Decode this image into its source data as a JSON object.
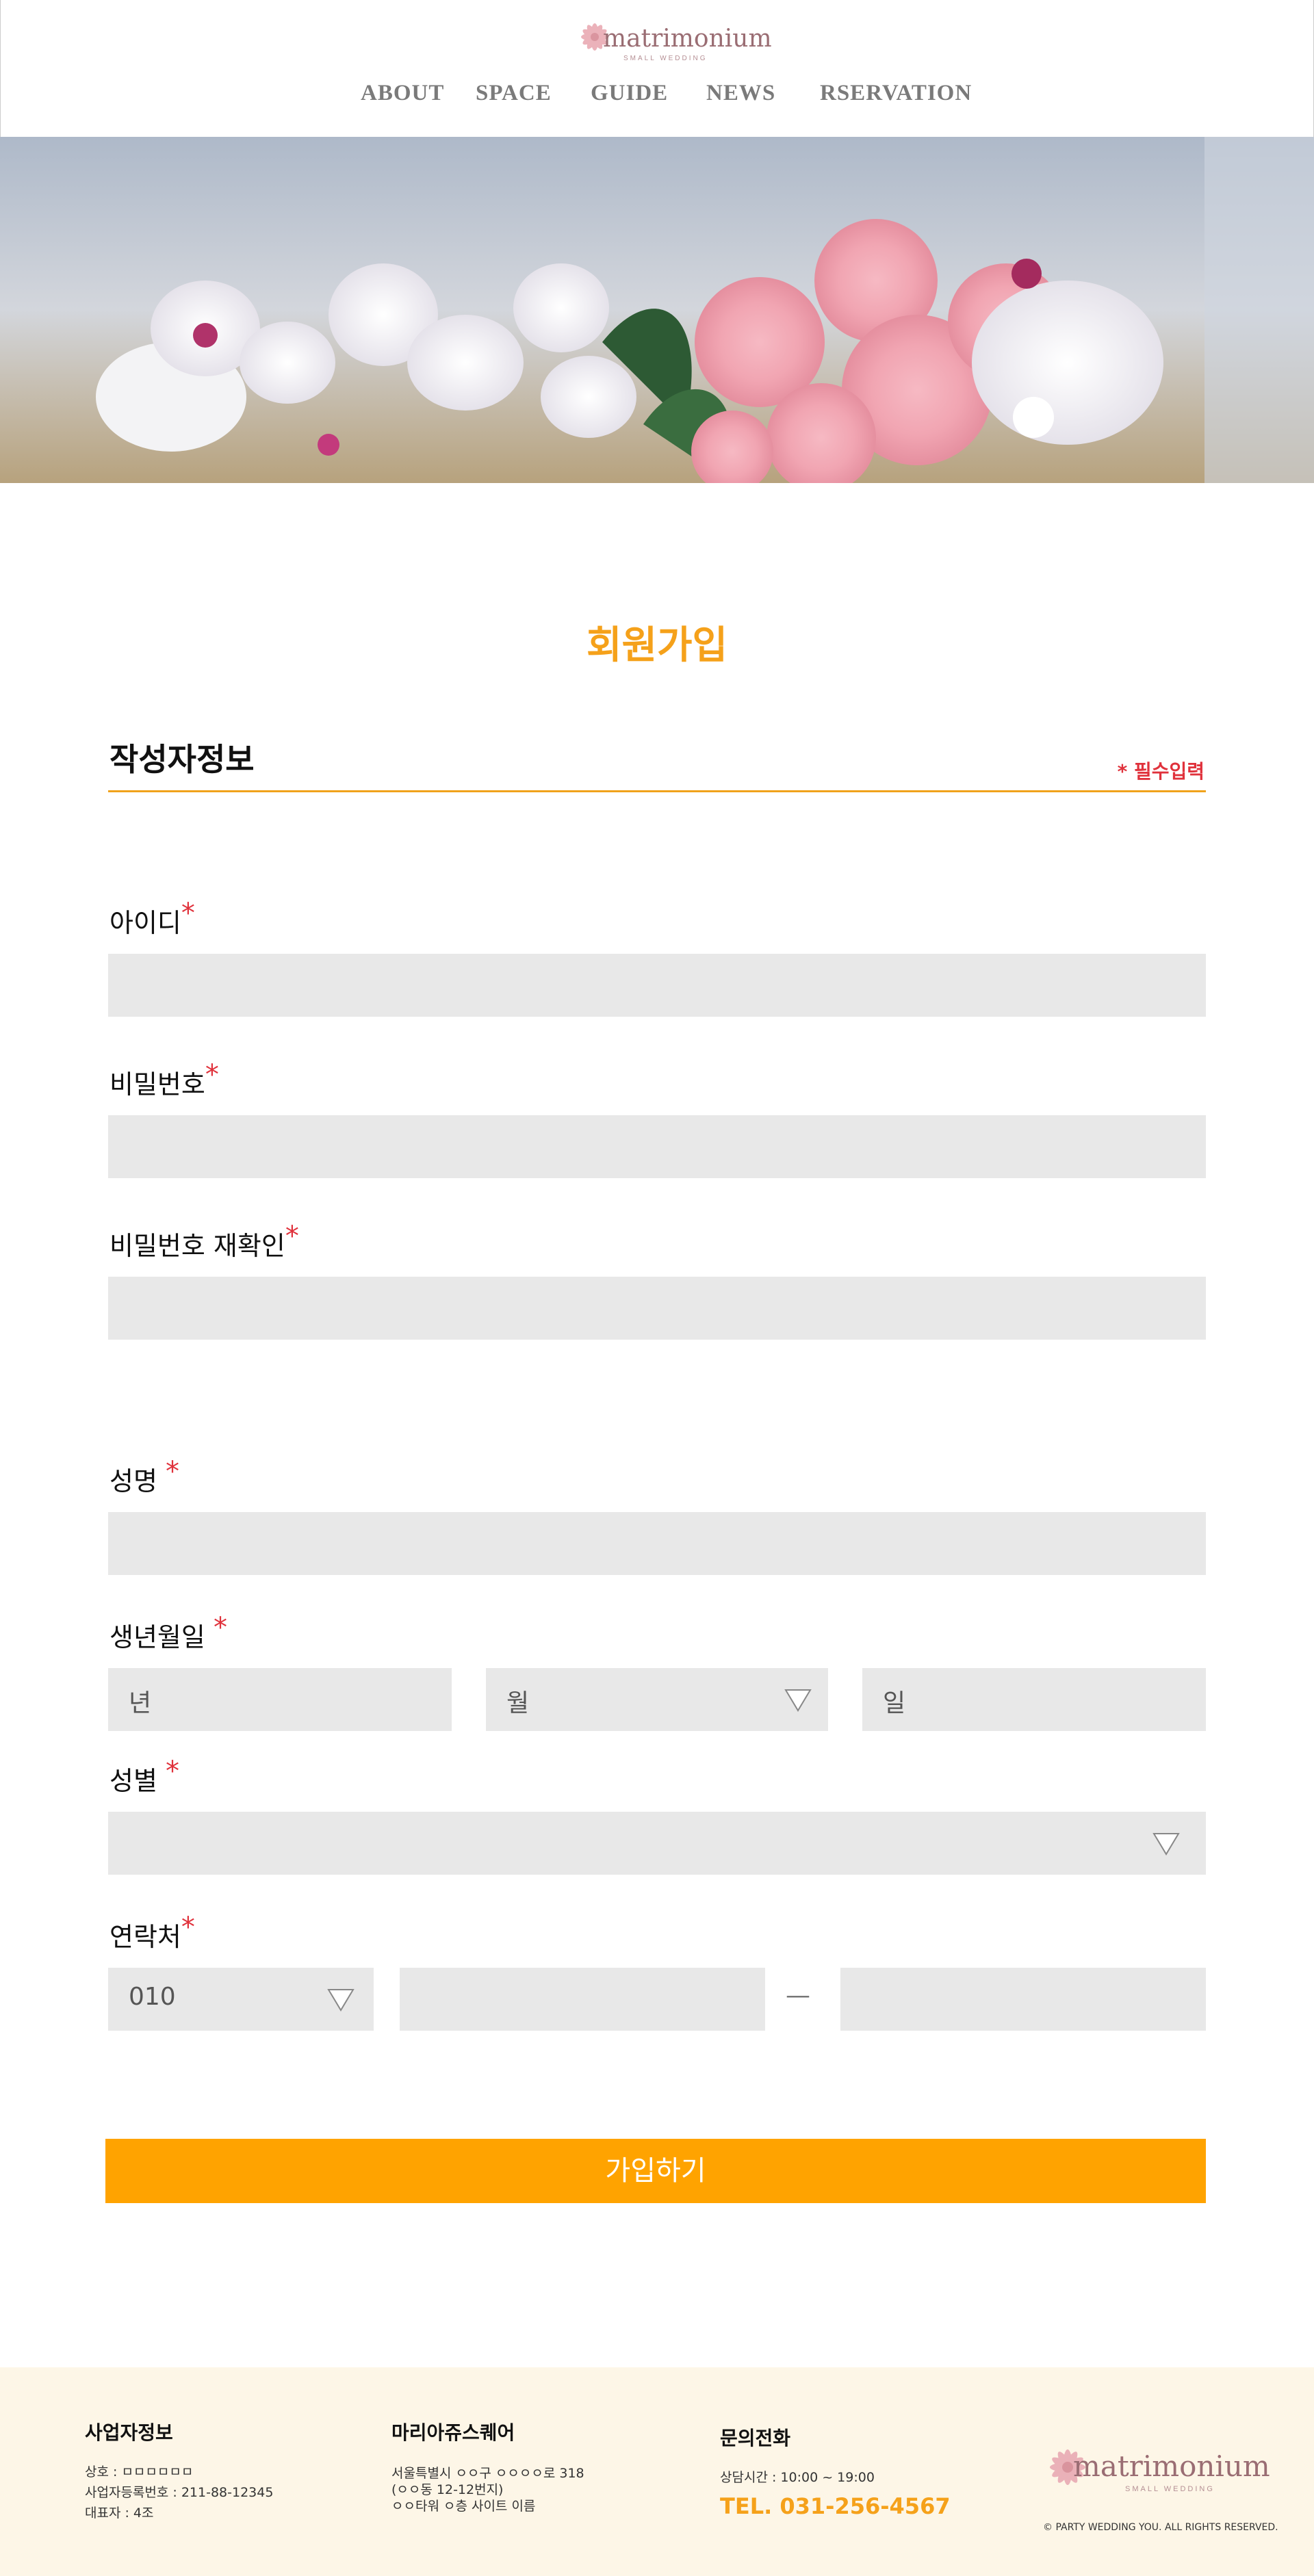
{
  "brand": {
    "name": "matrimonium",
    "tagline": "SMALL WEDDING"
  },
  "nav": {
    "items": [
      "ABOUT",
      "SPACE",
      "GUIDE",
      "NEWS",
      "RSERVATION"
    ]
  },
  "form": {
    "title": "회원가입",
    "section": "작성자정보",
    "required_note": "* 필수입력",
    "star": "*",
    "fields": {
      "id": {
        "label": "아이디"
      },
      "password": {
        "label": "비밀번호"
      },
      "password_confirm": {
        "label": "비밀번호 재확인"
      },
      "name": {
        "label": "성명"
      },
      "birth": {
        "label": "생년월일",
        "year_placeholder": "년",
        "month_placeholder": "월",
        "day_placeholder": "일"
      },
      "gender": {
        "label": "성별"
      },
      "phone": {
        "label": "연락처",
        "prefix": "010",
        "separator": "—"
      }
    },
    "submit_label": "가입하기"
  },
  "footer": {
    "business": {
      "title": "사업자정보",
      "line1": "상호 : ㅁㅁㅁㅁㅁㅁ",
      "line2": "사업자등록번호 : 211-88-12345",
      "line3": "대표자 : 4조"
    },
    "venue": {
      "title": "마리아쥬스퀘어",
      "line1": "서울특별시 ㅇㅇ구 ㅇㅇㅇㅇ로 318",
      "line2": "(ㅇㅇ동 12-12번지)",
      "line3": "ㅇㅇ타워 ㅇ층 사이트 이름"
    },
    "contact": {
      "title": "문의전화",
      "hours": "상담시간 : 10:00 ~ 19:00",
      "tel": "TEL. 031-256-4567"
    },
    "copyright": "© PARTY WEDDING YOU. ALL RIGHTS RESERVED."
  },
  "colors": {
    "accent": "#ffa300",
    "title": "#f5a11a",
    "required": "#e0323c",
    "field_bg": "#e8e8e8",
    "footer_bg": "#fdf6e7"
  },
  "icons": {
    "logo": "flower-logo-icon",
    "dropdown": "triangle-down-icon"
  }
}
